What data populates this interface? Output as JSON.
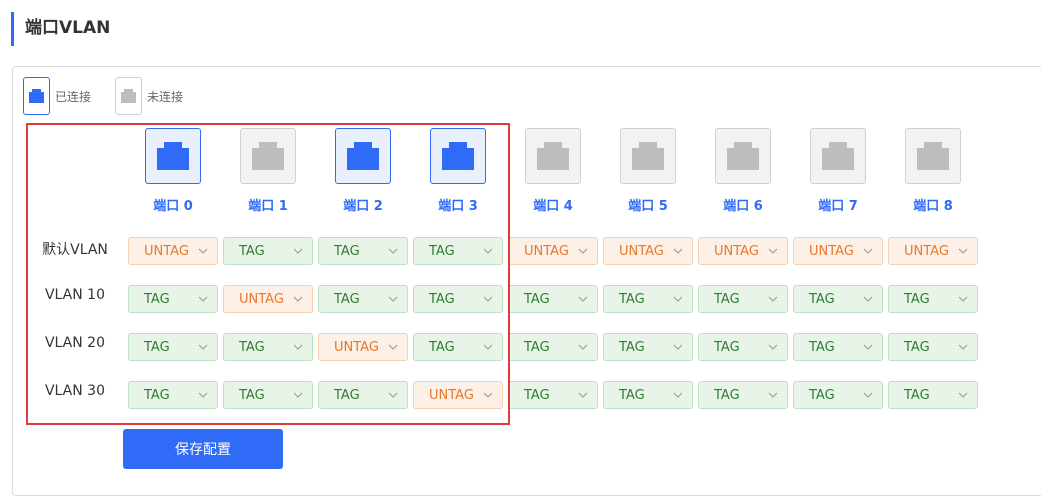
{
  "page": {
    "title": "端口VLAN"
  },
  "legend": {
    "connected": "已连接",
    "disconnected": "未连接"
  },
  "colors": {
    "accent": "#2f6bf6",
    "tag_text": "#2e7d32",
    "untag_text": "#e8782c",
    "highlight": "#e23b3b"
  },
  "ports": [
    {
      "label": "端口 0",
      "connected": true
    },
    {
      "label": "端口 1",
      "connected": false
    },
    {
      "label": "端口 2",
      "connected": true
    },
    {
      "label": "端口 3",
      "connected": true
    },
    {
      "label": "端口 4",
      "connected": false
    },
    {
      "label": "端口 5",
      "connected": false
    },
    {
      "label": "端口 6",
      "connected": false
    },
    {
      "label": "端口 7",
      "connected": false
    },
    {
      "label": "端口 8",
      "connected": false
    }
  ],
  "vlans": [
    {
      "label": "默认VLAN",
      "values": [
        "UNTAG",
        "TAG",
        "TAG",
        "TAG",
        "UNTAG",
        "UNTAG",
        "UNTAG",
        "UNTAG",
        "UNTAG"
      ]
    },
    {
      "label": "VLAN 10",
      "values": [
        "TAG",
        "UNTAG",
        "TAG",
        "TAG",
        "TAG",
        "TAG",
        "TAG",
        "TAG",
        "TAG"
      ]
    },
    {
      "label": "VLAN 20",
      "values": [
        "TAG",
        "TAG",
        "UNTAG",
        "TAG",
        "TAG",
        "TAG",
        "TAG",
        "TAG",
        "TAG"
      ]
    },
    {
      "label": "VLAN 30",
      "values": [
        "TAG",
        "TAG",
        "TAG",
        "UNTAG",
        "TAG",
        "TAG",
        "TAG",
        "TAG",
        "TAG"
      ]
    }
  ],
  "save_button": "保存配置"
}
